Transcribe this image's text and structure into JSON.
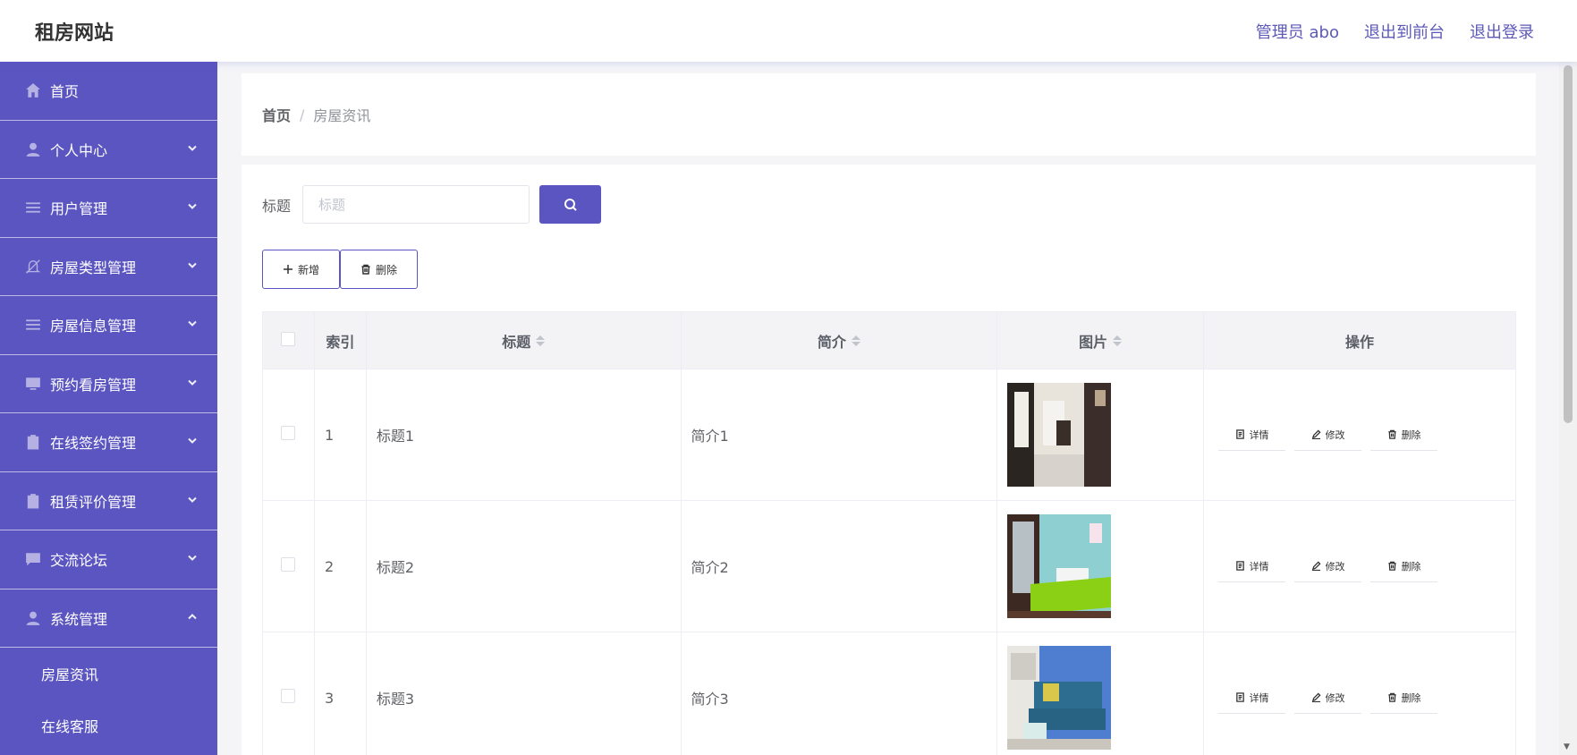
{
  "header": {
    "brand": "租房网站",
    "user": "管理员 abo",
    "back_to_front": "退出到前台",
    "logout": "退出登录"
  },
  "sidebar": {
    "items": [
      {
        "label": "首页",
        "icon": "home-icon",
        "has_chevron": false
      },
      {
        "label": "个人中心",
        "icon": "user-icon",
        "has_chevron": true,
        "chevron": "down"
      },
      {
        "label": "用户管理",
        "icon": "list-icon",
        "has_chevron": true,
        "chevron": "down"
      },
      {
        "label": "房屋类型管理",
        "icon": "bell-off-icon",
        "has_chevron": true,
        "chevron": "down"
      },
      {
        "label": "房屋信息管理",
        "icon": "list-icon",
        "has_chevron": true,
        "chevron": "down"
      },
      {
        "label": "预约看房管理",
        "icon": "monitor-icon",
        "has_chevron": true,
        "chevron": "down"
      },
      {
        "label": "在线签约管理",
        "icon": "clipboard-icon",
        "has_chevron": true,
        "chevron": "down"
      },
      {
        "label": "租赁评价管理",
        "icon": "clipboard-icon",
        "has_chevron": true,
        "chevron": "down"
      },
      {
        "label": "交流论坛",
        "icon": "chat-icon",
        "has_chevron": true,
        "chevron": "down"
      },
      {
        "label": "系统管理",
        "icon": "user-icon",
        "has_chevron": true,
        "chevron": "up"
      }
    ],
    "subitems": [
      "房屋资讯",
      "在线客服"
    ]
  },
  "breadcrumb": {
    "home": "首页",
    "separator": "/",
    "current": "房屋资讯"
  },
  "search": {
    "label": "标题",
    "placeholder": "标题",
    "value": ""
  },
  "actions": {
    "add": "新增",
    "delete": "删除"
  },
  "table": {
    "headers": {
      "index": "索引",
      "title": "标题",
      "intro": "简介",
      "image": "图片",
      "ops": "操作"
    },
    "rows": [
      {
        "index": "1",
        "title": "标题1",
        "intro": "简介1",
        "image": "hallway-photo"
      },
      {
        "index": "2",
        "title": "标题2",
        "intro": "简介2",
        "image": "bedroom-photo"
      },
      {
        "index": "3",
        "title": "标题3",
        "intro": "简介3",
        "image": "living-room-photo"
      }
    ],
    "row_ops": {
      "detail": "详情",
      "edit": "修改",
      "delete": "删除"
    }
  },
  "colors": {
    "primary": "#5b55c1",
    "header_link": "#5c59b8"
  }
}
